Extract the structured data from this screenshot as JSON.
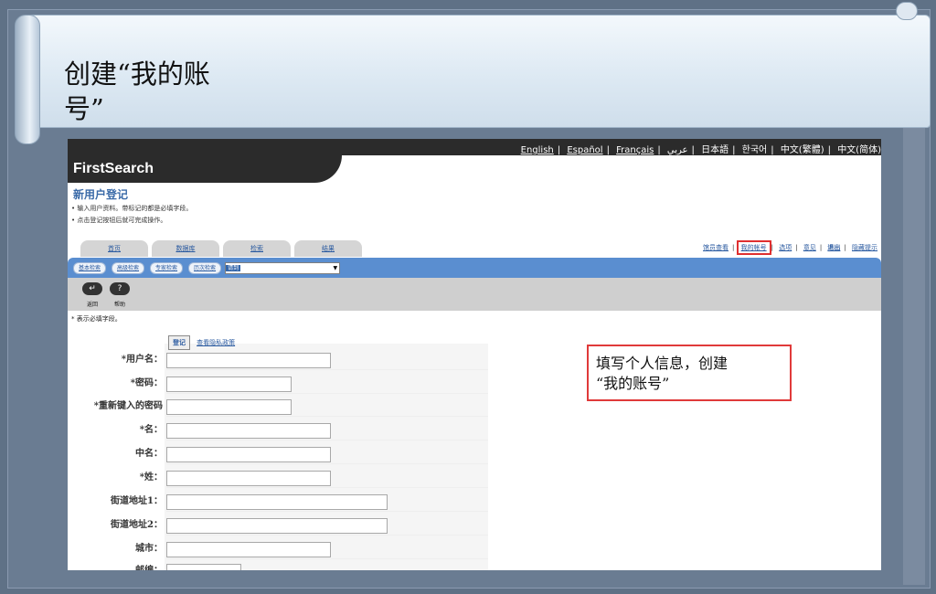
{
  "slide": {
    "title_line1": "创建“我的账",
    "title_line2": "号”"
  },
  "screenshot": {
    "logo": "FirstSearch",
    "languages": [
      "English",
      "Español",
      "Français",
      "عربي",
      "日本語",
      "한국어",
      "中文(繁體)",
      "中文(简体)"
    ],
    "page_heading": "新用户登记",
    "notes": [
      "输入用户资料。带标记的都是必填字段。",
      "点击登记按钮后就可完成操作。"
    ],
    "tabs": [
      "首页",
      "数据库",
      "检索",
      "结果"
    ],
    "right_links": [
      "馆员查看",
      "我的帐号",
      "选项",
      "意见",
      "退出",
      "隐藏提示"
    ],
    "subtabs": [
      "基本检索",
      "高级检索",
      "专家检索",
      "历次检索"
    ],
    "db_select_value": "请到",
    "toolbar": {
      "back_label": "返回",
      "help_label": "帮助",
      "back_icon": "↵",
      "help_icon": "?"
    },
    "required_note": "* 表示必填字段。",
    "submit_label": "登记",
    "privacy_link": "查看隐私政策",
    "fields": [
      {
        "label": "*用户名："
      },
      {
        "label": "*密码："
      },
      {
        "label": "*重新键入的密码"
      },
      {
        "label": "*名："
      },
      {
        "label": "中名："
      },
      {
        "label": "*姓："
      },
      {
        "label": "街道地址1："
      },
      {
        "label": "街道地址2："
      },
      {
        "label": "城市："
      },
      {
        "label": "邮编："
      }
    ]
  },
  "callout": {
    "line1": "填写个人信息，创建",
    "line2": "“我的账号”"
  },
  "colors": {
    "highlight": "#e03a3a",
    "link": "#2a5aa0",
    "bar": "#5a8ed0"
  }
}
